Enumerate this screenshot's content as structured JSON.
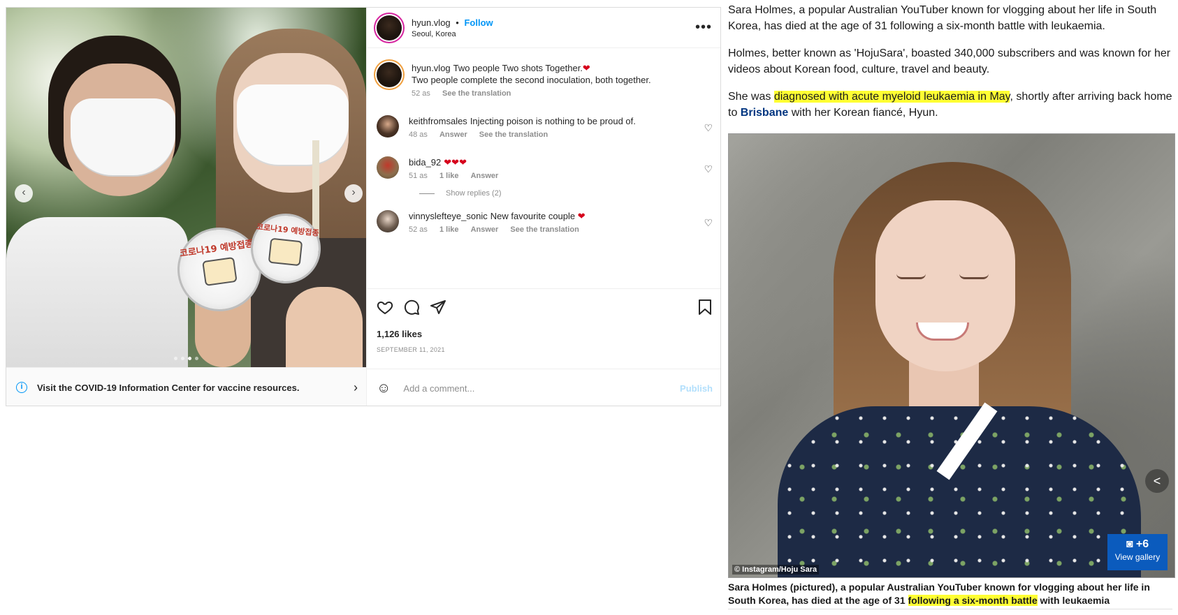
{
  "instagram": {
    "photo": {
      "badge_text_1": "코로나19 예방접종",
      "badge_text_2": "코로나19 예방접종",
      "prev": "‹",
      "next": "›",
      "slide_count": 4,
      "active_slide": 3
    },
    "covid_banner": {
      "text": "Visit the COVID-19 Information Center for vaccine resources.",
      "icon": "info-icon"
    },
    "header": {
      "username": "hyun.vlog",
      "separator": "•",
      "follow_label": "Follow",
      "location": "Seoul, Korea",
      "more_label": "•••"
    },
    "caption": {
      "username": "hyun.vlog",
      "text": "Two people Two shots Together.",
      "emoji": "❤",
      "text2": "Two people complete the second inoculation, both together.",
      "time": "52 as",
      "translate": "See the translation"
    },
    "comments": [
      {
        "username": "keithfromsales",
        "text": "Injecting poison is nothing to be proud of.",
        "time": "48 as",
        "answer": "Answer",
        "translate": "See the translation"
      },
      {
        "username": "bida_92",
        "text": "❤❤❤",
        "time": "51 as",
        "likes": "1 like",
        "answer": "Answer",
        "replies": "Show replies (2)"
      },
      {
        "username": "vinnyslefteye_sonic",
        "text": "New favourite couple",
        "emoji": "❤",
        "time": "52 as",
        "likes": "1 like",
        "answer": "Answer",
        "translate": "See the translation"
      }
    ],
    "actions": {
      "likes": "1,126 likes",
      "date": "SEPTEMBER 11, 2021",
      "icons": [
        "heart-icon",
        "comment-icon",
        "share-icon",
        "bookmark-icon"
      ]
    },
    "comment_box": {
      "placeholder": "Add a comment...",
      "publish": "Publish"
    },
    "colors": {
      "follow": "#0095f6",
      "publish_disabled": "#b2dffc",
      "text": "#262626",
      "muted": "#8e8e8e"
    }
  },
  "article": {
    "p1": "Sara Holmes, a popular Australian YouTuber known for vlogging about her life in South Korea, has died at the age of 31 following a six-month battle with leukaemia.",
    "p2": "Holmes, better known as 'HojuSara', boasted 340,000 subscribers and was known for her videos about Korean food, culture, travel and beauty.",
    "p3_before": "She was ",
    "p3_highlight": "diagnosed with acute myeloid leukaemia in May",
    "p3_mid": ", shortly after arriving back home to ",
    "p3_link": "Brisbane",
    "p3_after": " with her Korean fiancé, Hyun.",
    "photo": {
      "credit": "© Instagram/Hoju Sara",
      "gallery_count": "+6",
      "gallery_label": "View gallery",
      "share_icon": "share-icon"
    },
    "caption_before": "Sara Holmes (pictured), a popular Australian YouTuber known for vlogging about her life in South Korea, has died at the age of 31 ",
    "caption_highlight": "following a six-month battle",
    "caption_after": " with leukaemia",
    "colors": {
      "highlight": "#ffff33",
      "link": "#003580",
      "gallery_button": "#0b5bbd"
    }
  }
}
